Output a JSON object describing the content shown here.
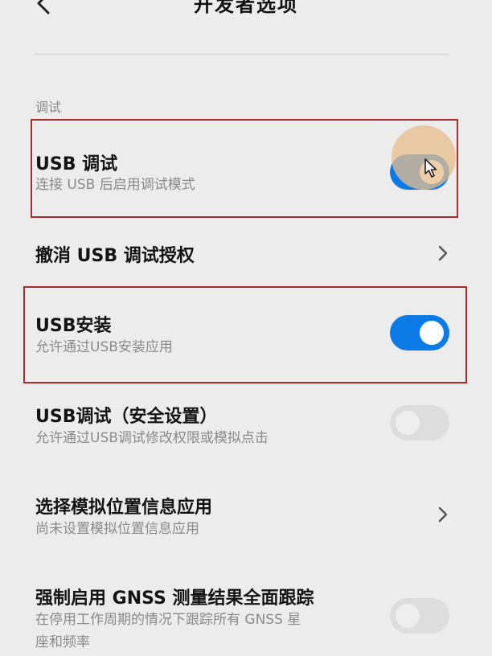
{
  "header": {
    "title": "开发者选项",
    "back_icon": "chevron-left-icon"
  },
  "section": {
    "label": "调试"
  },
  "rows": [
    {
      "title": "USB 调试",
      "subtitle": "连接 USB 后启用调试模式",
      "control": "toggle",
      "enabled": true,
      "highlighted": true
    },
    {
      "title": "撤消 USB 调试授权",
      "control": "chevron",
      "icon": "chevron-right-icon"
    },
    {
      "title": "USB安装",
      "subtitle": "允许通过USB安装应用",
      "control": "toggle",
      "enabled": true,
      "highlighted": true
    },
    {
      "title": "USB调试（安全设置）",
      "subtitle": "允许通过USB调试修改权限或模拟点击",
      "control": "toggle",
      "enabled": false
    },
    {
      "title": "选择模拟位置信息应用",
      "subtitle": "尚未设置模拟位置信息应用",
      "control": "chevron",
      "icon": "chevron-right-icon"
    },
    {
      "title": "强制启用 GNSS 测量结果全面跟踪",
      "subtitle_line1": "在停用工作周期的情况下跟踪所有 GNSS 星",
      "subtitle_line2": "座和频率",
      "control": "toggle",
      "enabled": false
    }
  ],
  "colors": {
    "toggle_on": "#0d7be6",
    "toggle_off": "#dddddd",
    "highlight_border": "#b02a2a",
    "background": "#ececec"
  },
  "overlay": {
    "touch_indicator": "touch-ripple",
    "cursor_icon": "mouse-pointer-icon"
  }
}
